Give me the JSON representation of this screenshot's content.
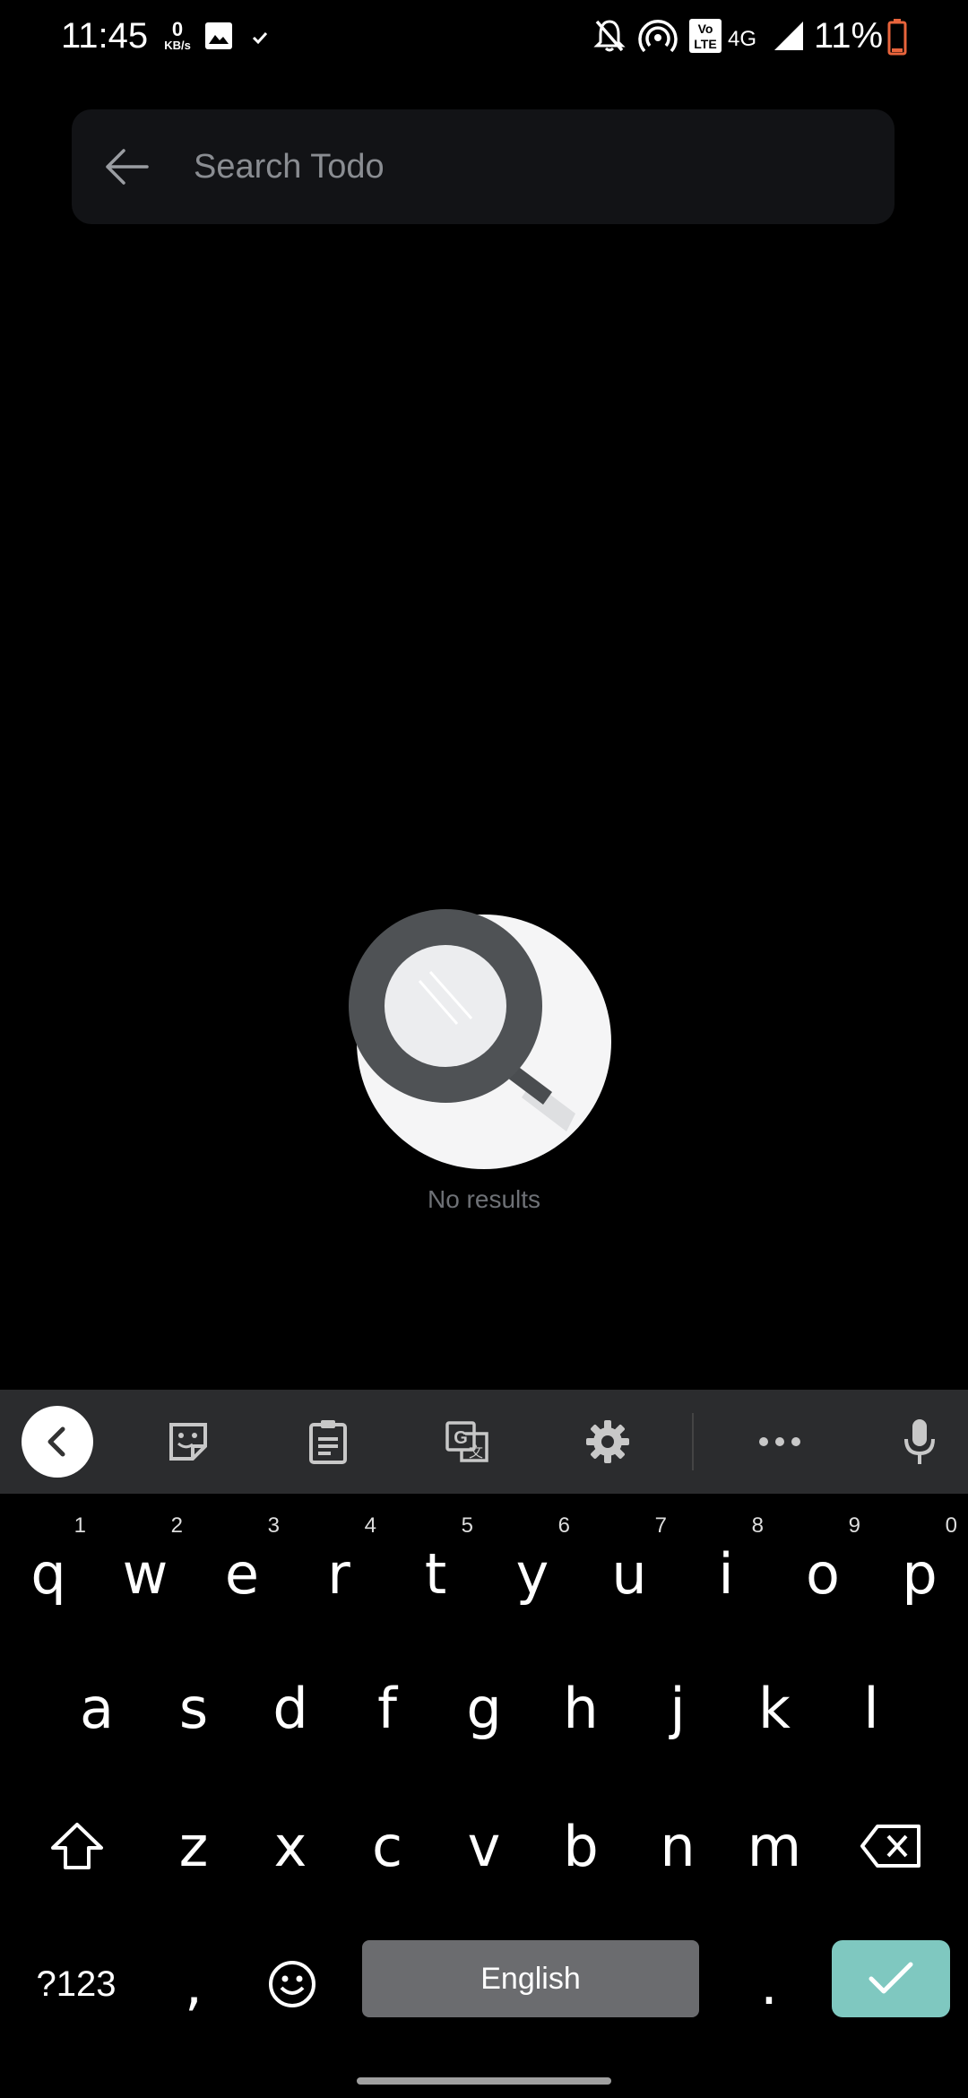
{
  "status_bar": {
    "time": "11:45",
    "net_speed_value": "0",
    "net_speed_unit": "KB/s",
    "network_type": "4G",
    "volte_label": "Vo LTE",
    "battery_percent": "11%",
    "battery_color": "#e8643c",
    "icons": [
      "image-icon",
      "check-icon",
      "bell-off-icon",
      "hotspot-icon",
      "volte-icon",
      "signal-icon",
      "battery-icon"
    ]
  },
  "search": {
    "placeholder": "Search Todo",
    "value": ""
  },
  "empty_state": {
    "icon": "magnifier-illustration",
    "text": "No results"
  },
  "keyboard": {
    "toolbar_icons": [
      "collapse-icon",
      "sticker-icon",
      "clipboard-icon",
      "translate-icon",
      "settings-icon",
      "more-icon",
      "mic-icon"
    ],
    "row1": [
      {
        "key": "q",
        "hint": "1"
      },
      {
        "key": "w",
        "hint": "2"
      },
      {
        "key": "e",
        "hint": "3"
      },
      {
        "key": "r",
        "hint": "4"
      },
      {
        "key": "t",
        "hint": "5"
      },
      {
        "key": "y",
        "hint": "6"
      },
      {
        "key": "u",
        "hint": "7"
      },
      {
        "key": "i",
        "hint": "8"
      },
      {
        "key": "o",
        "hint": "9"
      },
      {
        "key": "p",
        "hint": "0"
      }
    ],
    "row2": [
      "a",
      "s",
      "d",
      "f",
      "g",
      "h",
      "j",
      "k",
      "l"
    ],
    "row3": [
      "z",
      "x",
      "c",
      "v",
      "b",
      "n",
      "m"
    ],
    "symbols_label": "?123",
    "comma": ",",
    "space_label": "English",
    "period": ".",
    "accent_color": "#7fc8c0"
  }
}
